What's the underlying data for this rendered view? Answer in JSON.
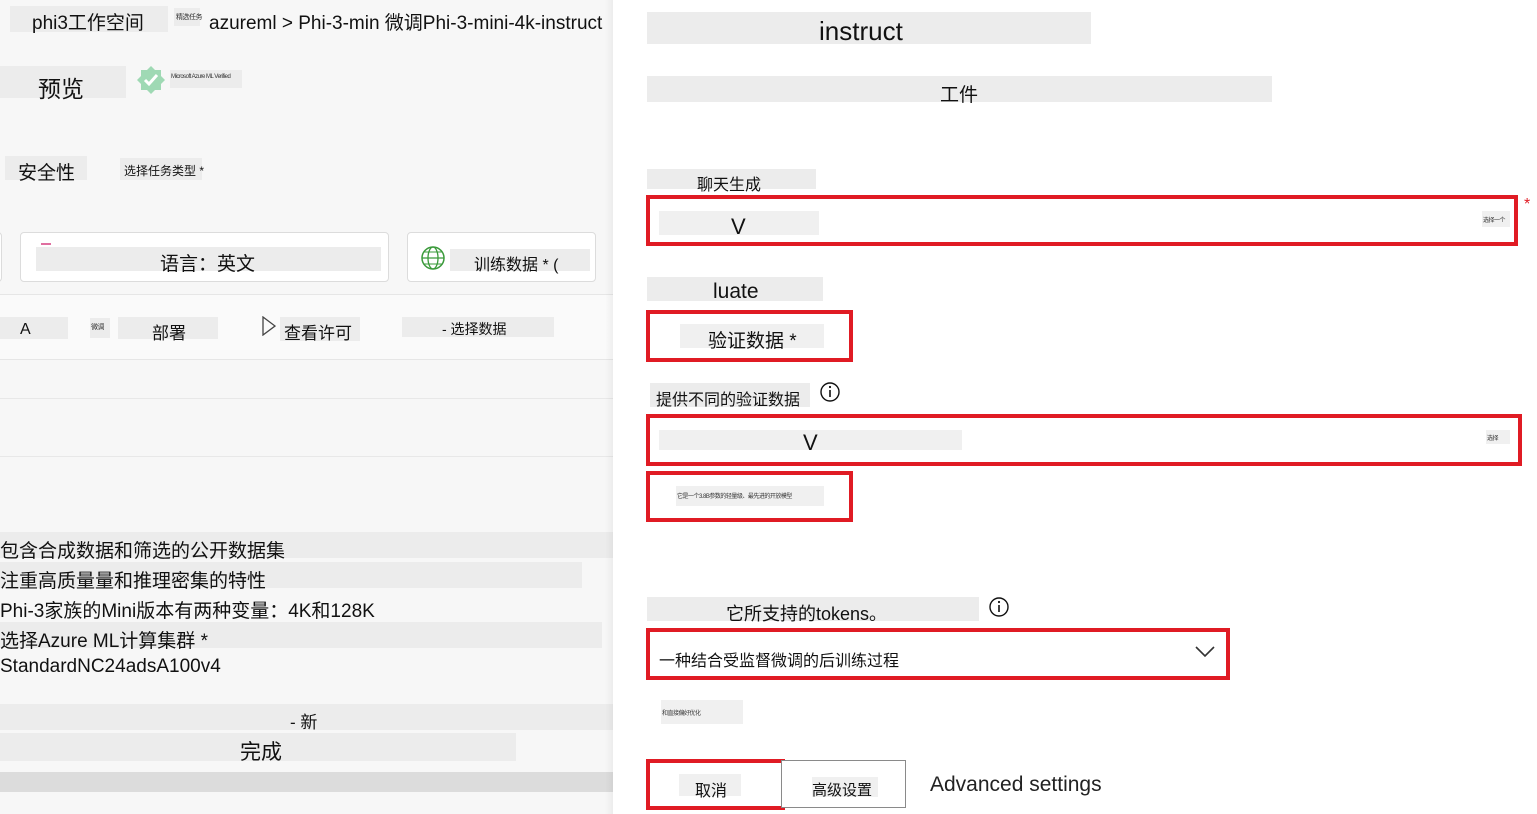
{
  "header": {
    "workspace": "phi3工作空间",
    "tiny_label": "精选任务",
    "breadcrumb": "azureml > Phi-3-min 微调Phi-3-mini-4k-instruct"
  },
  "left": {
    "preview": "预览",
    "verified_tiny": "Microsoft Azure ML Verified",
    "safety": "安全性",
    "task_type_label": "选择任务类型 *",
    "language": "语言：英文",
    "training_data": "训练数据 * (",
    "tab_a": "A",
    "tab_tiny": "微调",
    "tab_deploy": "部署",
    "tab_license": "查看许可",
    "tab_select_data": "- 选择数据",
    "desc": [
      "包含合成数据和筛选的公开数据集",
      "注重高质量量和推理密集的特性",
      "Phi-3家族的Mini版本有两种变量：4K和128K",
      "选择Azure ML计算集群 *",
      "StandardNC24adsA100v4"
    ],
    "new_label": "- 新",
    "done_label": "完成"
  },
  "right": {
    "title": "instruct",
    "subtitle": "工件",
    "chat_label": "聊天生成",
    "select1_value": "V",
    "select1_tiny": "选择一个",
    "required_mark": "*",
    "evaluate_label": "luate",
    "validation_label": "验证数据 *",
    "provide_label": "提供不同的验证数据",
    "select2_value": "V",
    "select2_tiny": "选择",
    "hint_tiny": "它是一个3.8B参数的轻量级、最先进的开放模型",
    "tokens_label": "它所支持的tokens。",
    "dropdown_value": "一种结合受监督微调的后训练过程",
    "tiny_after": "和直接偏好优化",
    "cancel": "取消",
    "advanced_button": "高级设置",
    "advanced_text": "Advanced settings"
  },
  "colors": {
    "accent_red": "#e01b24",
    "verified_green": "#7ec99a"
  }
}
